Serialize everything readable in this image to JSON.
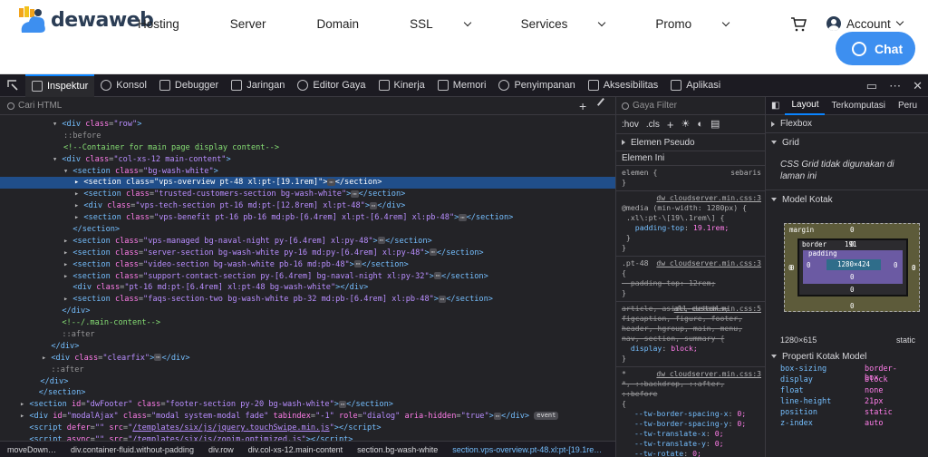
{
  "site": {
    "logo_text": "dewaweb",
    "nav": [
      {
        "label": "Hosting",
        "chevron": false
      },
      {
        "label": "Server",
        "chevron": false
      },
      {
        "label": "Domain",
        "chevron": false
      },
      {
        "label": "SSL",
        "chevron": true
      },
      {
        "label": "Services",
        "chevron": true
      },
      {
        "label": "Promo",
        "chevron": true
      }
    ],
    "account_label": "Account",
    "chat_label": "Chat"
  },
  "devtools": {
    "tabs": [
      "Inspektur",
      "Konsol",
      "Debugger",
      "Jaringan",
      "Editor Gaya",
      "Kinerja",
      "Memori",
      "Penyimpanan",
      "Aksesibilitas",
      "Aplikasi"
    ],
    "search_placeholder": "Cari HTML",
    "tree": [
      {
        "d": 3,
        "html": "▾ <span class=\"tg\">&lt;div</span> <span class=\"at\">class</span>=<span class=\"av\">\"row\"</span><span class=\"tg\">&gt;</span>"
      },
      {
        "d": 4,
        "html": "<span class=\"ps\">::before</span>"
      },
      {
        "d": 4,
        "html": "<span class=\"cm\">&lt;!--Container for main page display content--&gt;</span>"
      },
      {
        "d": 3,
        "html": "▾ <span class=\"tg\">&lt;div</span> <span class=\"at\">class</span>=<span class=\"av\">\"col-xs-12 main-content\"</span><span class=\"tg\">&gt;</span>"
      },
      {
        "d": 4,
        "html": "▾ <span class=\"tg\">&lt;section</span> <span class=\"at\">class</span>=<span class=\"av\">\"bg-wash-white\"</span><span class=\"tg\">&gt;</span>"
      },
      {
        "d": 5,
        "sel": true,
        "html": "▸ <span class=\"tg\">&lt;section</span> <span class=\"at\">class</span>=<span class=\"av\">\"vps-overview pt-48 xl:pt-[19.1rem]\"</span><span class=\"tg\">&gt;</span><span class=\"dots\">⋯</span><span class=\"tg\">&lt;/section&gt;</span>"
      },
      {
        "d": 5,
        "html": "▸ <span class=\"tg\">&lt;section</span> <span class=\"at\">class</span>=<span class=\"av\">\"trusted-customers-section bg-wash-white\"</span><span class=\"tg\">&gt;</span><span class=\"dots\">⋯</span><span class=\"tg\">&lt;/section&gt;</span>"
      },
      {
        "d": 5,
        "html": "▸ <span class=\"tg\">&lt;div</span> <span class=\"at\">class</span>=<span class=\"av\">\"vps-tech-section pt-16 md:pt-[12.8rem] xl:pt-48\"</span><span class=\"tg\">&gt;</span><span class=\"dots\">⋯</span><span class=\"tg\">&lt;/div&gt;</span>"
      },
      {
        "d": 5,
        "html": "▸ <span class=\"tg\">&lt;section</span> <span class=\"at\">class</span>=<span class=\"av\">\"vps-benefit pt-16 pb-16 md:pb-[6.4rem] xl:pt-[6.4rem] xl:pb-48\"</span><span class=\"tg\">&gt;</span><span class=\"dots\">⋯</span><span class=\"tg\">&lt;/section&gt;</span>"
      },
      {
        "d": 4,
        "html": "  <span class=\"tg\">&lt;/section&gt;</span>"
      },
      {
        "d": 4,
        "html": "▸ <span class=\"tg\">&lt;section</span> <span class=\"at\">class</span>=<span class=\"av\">\"vps-managed bg-naval-night py-[6.4rem] xl:py-48\"</span><span class=\"tg\">&gt;</span><span class=\"dots\">⋯</span><span class=\"tg\">&lt;/section&gt;</span>"
      },
      {
        "d": 4,
        "html": "▸ <span class=\"tg\">&lt;section</span> <span class=\"at\">class</span>=<span class=\"av\">\"server-section bg-wash-white py-16 md:py-[6.4rem] xl:py-48\"</span><span class=\"tg\">&gt;</span><span class=\"dots\">⋯</span><span class=\"tg\">&lt;/section&gt;</span>"
      },
      {
        "d": 4,
        "html": "▸ <span class=\"tg\">&lt;section</span> <span class=\"at\">class</span>=<span class=\"av\">\"video-section bg-wash-white pb-16 md:pb-48\"</span><span class=\"tg\">&gt;</span><span class=\"dots\">⋯</span><span class=\"tg\">&lt;/section&gt;</span>"
      },
      {
        "d": 4,
        "html": "▸ <span class=\"tg\">&lt;section</span> <span class=\"at\">class</span>=<span class=\"av\">\"support-contact-section py-[6.4rem] bg-naval-night xl:py-32\"</span><span class=\"tg\">&gt;</span><span class=\"dots\">⋯</span><span class=\"tg\">&lt;/section&gt;</span>"
      },
      {
        "d": 4,
        "html": "  <span class=\"tg\">&lt;div</span> <span class=\"at\">class</span>=<span class=\"av\">\"pt-16 md:pt-[6.4rem] xl:pt-48 bg-wash-white\"</span><span class=\"tg\">&gt;&lt;/div&gt;</span>"
      },
      {
        "d": 4,
        "html": "▸ <span class=\"tg\">&lt;section</span> <span class=\"at\">class</span>=<span class=\"av\">\"faqs-section-two bg-wash-white pb-32 md:pb-[6.4rem] xl:pb-48\"</span><span class=\"tg\">&gt;</span><span class=\"dots\">⋯</span><span class=\"tg\">&lt;/section&gt;</span>"
      },
      {
        "d": 3,
        "html": "  <span class=\"tg\">&lt;/div&gt;</span>"
      },
      {
        "d": 3,
        "html": "  <span class=\"cm\">&lt;!--/.main-content--&gt;</span>"
      },
      {
        "d": 3,
        "html": "  <span class=\"ps\">::after</span>"
      },
      {
        "d": 2,
        "html": "  <span class=\"tg\">&lt;/div&gt;</span>"
      },
      {
        "d": 2,
        "html": "▸ <span class=\"tg\">&lt;div</span> <span class=\"at\">class</span>=<span class=\"av\">\"clearfix\"</span><span class=\"tg\">&gt;</span><span class=\"dots\">⋯</span><span class=\"tg\">&lt;/div&gt;</span>"
      },
      {
        "d": 2,
        "html": "  <span class=\"ps\">::after</span>"
      },
      {
        "d": 1,
        "html": "  <span class=\"tg\">&lt;/div&gt;</span>"
      },
      {
        "d": 0,
        "html": "    <span class=\"tg\">&lt;/section&gt;</span>"
      },
      {
        "d": 0,
        "html": "▸ <span class=\"tg\">&lt;section</span> <span class=\"at\">id</span>=<span class=\"av\">\"dwFooter\"</span> <span class=\"at\">class</span>=<span class=\"av\">\"footer-section py-20 bg-wash-white\"</span><span class=\"tg\">&gt;</span><span class=\"dots\">⋯</span><span class=\"tg\">&lt;/section&gt;</span>"
      },
      {
        "d": 0,
        "html": "▸ <span class=\"tg\">&lt;div</span> <span class=\"at\">id</span>=<span class=\"av\">\"modalAjax\"</span> <span class=\"at\">class</span>=<span class=\"av\">\"modal system-modal fade\"</span> <span class=\"at\">tabindex</span>=<span class=\"av\">\"-1\"</span> <span class=\"at\">role</span>=<span class=\"av\">\"dialog\"</span> <span class=\"at\">aria-hidden</span>=<span class=\"av\">\"true\"</span><span class=\"tg\">&gt;</span><span class=\"dots\">⋯</span><span class=\"tg\">&lt;/div&gt;</span> <span class=\"evt\">event</span>"
      },
      {
        "d": 0,
        "html": "  <span class=\"tg\">&lt;script</span> <span class=\"at\">defer</span>=<span class=\"av\">\"\"</span> <span class=\"at\">src</span>=<span class=\"av\">\"<u>/templates/six/js/jquery.touchSwipe.min.js</u>\"</span><span class=\"tg\">&gt;&lt;/script&gt;</span>"
      },
      {
        "d": 0,
        "html": "  <span class=\"tg\">&lt;script</span> <span class=\"at\">async</span>=<span class=\"av\">\"\"</span> <span class=\"at\">src</span>=<span class=\"av\">\"<u>/templates/six/js/zopim-optimized.js</u>\"</span><span class=\"tg\">&gt;&lt;/script&gt;</span>"
      }
    ],
    "breadcrumb": [
      "moveDown…",
      "div.container-fluid.without-padding",
      "div.row",
      "div.col-xs-12.main-content",
      "section.bg-wash-white",
      "section.vps-overview.pt-48.xl:pt-[19.1re…"
    ],
    "rules": {
      "filter_placeholder": "Gaya Filter",
      "hov": ":hov",
      "cls": ".cls",
      "pseudo_title": "Elemen Pseudo",
      "this_element": "Elemen Ini",
      "element_rule": "elemen",
      "inline": "sebaris",
      "file1": "dw_cloudserver.min.css:3",
      "media": "@media (min-width: 1280px) {",
      "selector1": ".xl\\:pt-\\[19\\.1rem\\]",
      "prop1": "padding-top",
      "val1": "19.1rem;",
      "selector2": ".pt-48",
      "prop2": "padding-top",
      "val2": "12rem;",
      "file2": "all-custom.min.css:5",
      "selector3": "article, aside, details, figcaption, figure, footer, header, hgroup, main, menu, nav, section, summary",
      "prop3": "display",
      "val3": "block;",
      "selector4": "*, ::backdrop, ::after, ::before",
      "vars": [
        "--tw-border-spacing-x: 0;",
        "--tw-border-spacing-y: 0;",
        "--tw-translate-x: 0;",
        "--tw-translate-y: 0;",
        "--tw-rotate: 0;"
      ]
    },
    "layout": {
      "tabs": [
        "Layout",
        "Terkomputasi",
        "Peru"
      ],
      "flexbox": "Flexbox",
      "grid": "Grid",
      "grid_note": "CSS Grid tidak digunakan di laman ini",
      "box_model": "Model Kotak",
      "margin_label": "margin",
      "border_label": "border",
      "padding_label": "padding",
      "margin_top": "0",
      "margin_bottom": "0",
      "margin_left": "0",
      "margin_right": "0",
      "border_top": "0",
      "border_bottom": "0",
      "border_left": "0",
      "border_right": "0",
      "padding_top": "191",
      "padding_bottom": "0",
      "padding_left": "0",
      "padding_right": "0",
      "content_size": "1280×424",
      "element_size": "1280×615",
      "position": "static",
      "props_title": "Properti Kotak Model",
      "props": [
        {
          "k": "box-sizing",
          "v": "border-box"
        },
        {
          "k": "display",
          "v": "block"
        },
        {
          "k": "float",
          "v": "none"
        },
        {
          "k": "line-height",
          "v": "21px"
        },
        {
          "k": "position",
          "v": "static"
        },
        {
          "k": "z-index",
          "v": "auto"
        }
      ]
    }
  },
  "colors": {
    "accent": "#0a84ff",
    "chat_button": "#3d8ff0",
    "selected_row": "#204e8a"
  }
}
